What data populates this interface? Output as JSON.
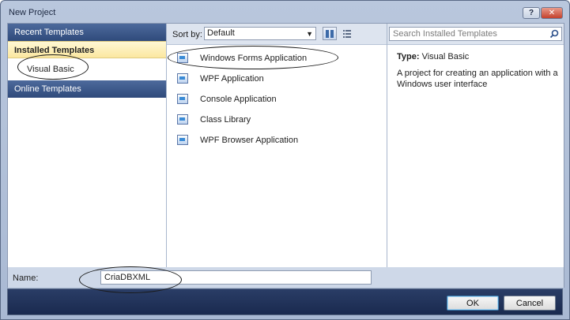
{
  "window": {
    "title": "New Project",
    "help_label": "?",
    "close_label": "✕"
  },
  "nav": {
    "recent": "Recent Templates",
    "installed": "Installed Templates",
    "installed_child": "Visual Basic",
    "online": "Online Templates"
  },
  "sort": {
    "label": "Sort by:",
    "selected": "Default"
  },
  "templates": [
    {
      "label": "Windows Forms Application"
    },
    {
      "label": "WPF Application"
    },
    {
      "label": "Console Application"
    },
    {
      "label": "Class Library"
    },
    {
      "label": "WPF Browser Application"
    }
  ],
  "search": {
    "placeholder": "Search Installed Templates"
  },
  "details": {
    "type_key": "Type:",
    "type_value": "Visual Basic",
    "description": "A project for creating an application with a Windows user interface"
  },
  "name": {
    "label": "Name:",
    "value": "CriaDBXML"
  },
  "buttons": {
    "ok": "OK",
    "cancel": "Cancel"
  },
  "icons": {
    "help": "help-icon",
    "close": "close-icon",
    "search": "search-icon",
    "dropdown": "chevron-down-icon",
    "list_view": "list-view-icon",
    "details_view": "details-view-icon",
    "template": "project-template-icon"
  },
  "colors": {
    "nav_header": "#2f4a7b",
    "nav_selected": "#fbe7a0",
    "button_bar": "#1a2a4f"
  }
}
